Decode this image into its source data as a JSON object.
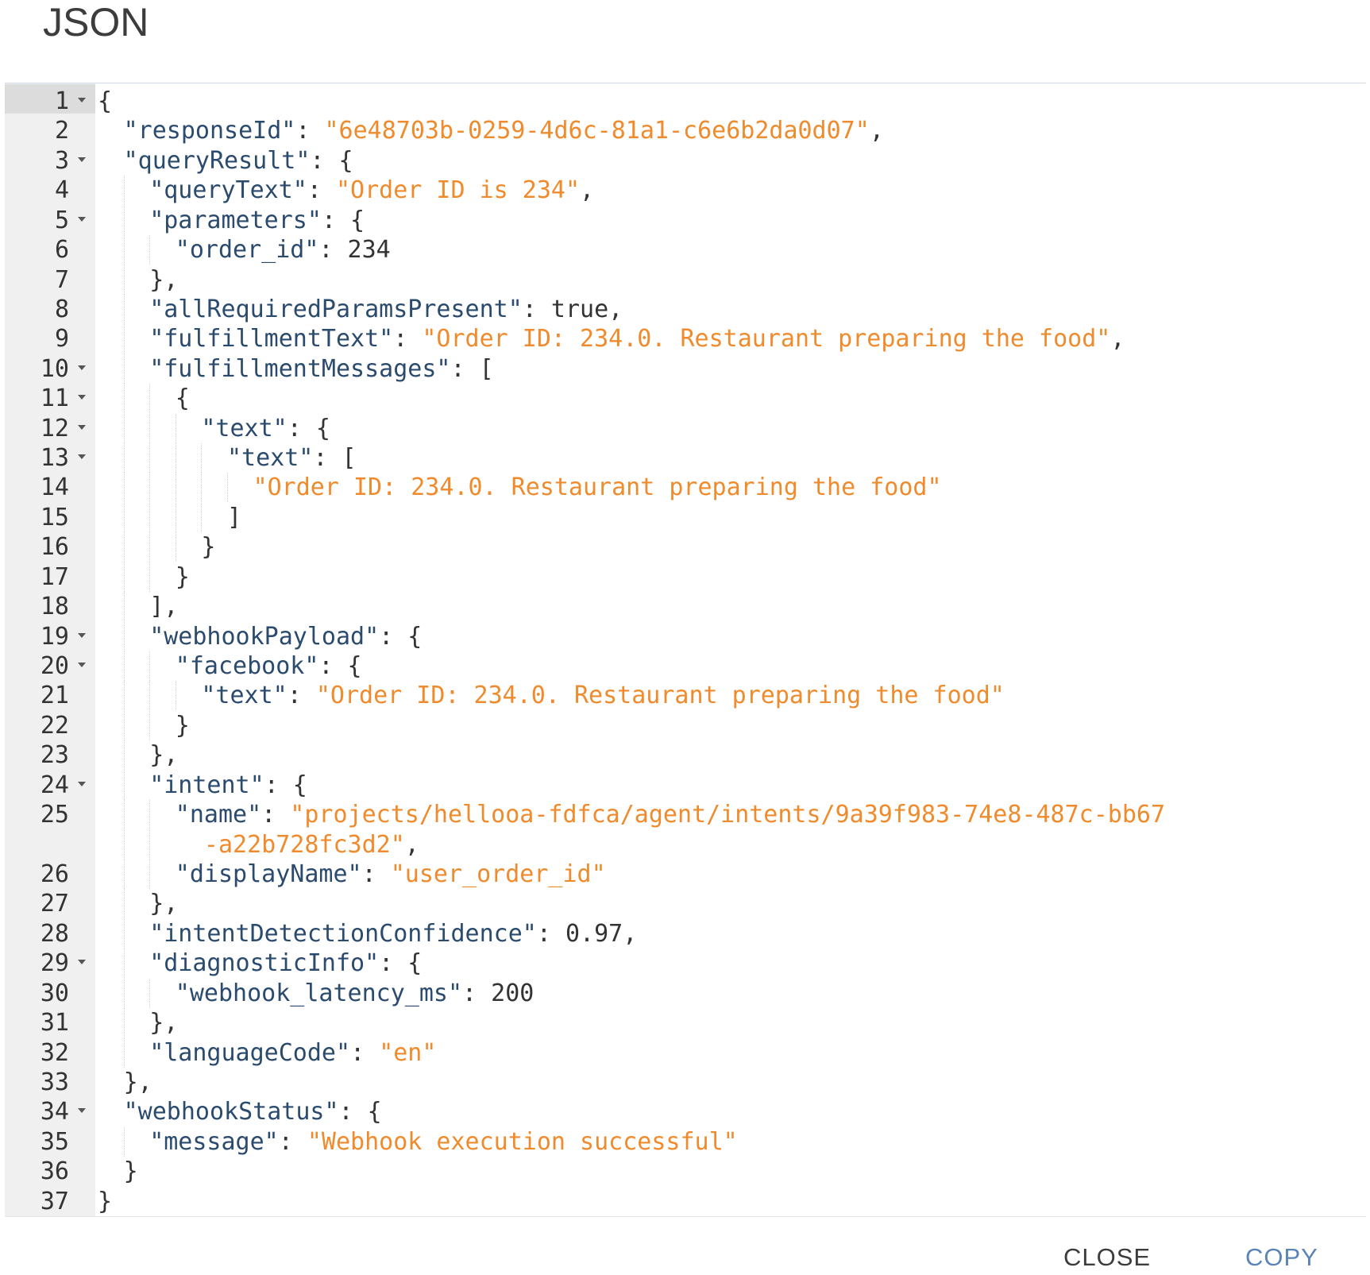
{
  "dialog": {
    "title": "JSON",
    "close_label": "CLOSE",
    "copy_label": "COPY"
  },
  "colors": {
    "key": "#2b4b6e",
    "string": "#ef8b2c",
    "text": "#333333",
    "copy_button": "#5b84b8",
    "gutter": "#f0f0f0"
  },
  "editor": {
    "lines": [
      {
        "num": "1",
        "fold": true,
        "indent": 0,
        "tokens": [
          [
            "punc",
            "{"
          ]
        ]
      },
      {
        "num": "2",
        "fold": false,
        "indent": 1,
        "tokens": [
          [
            "key",
            "\"responseId\""
          ],
          [
            "punc",
            ": "
          ],
          [
            "str",
            "\"6e48703b-0259-4d6c-81a1-c6e6b2da0d07\""
          ],
          [
            "punc",
            ","
          ]
        ]
      },
      {
        "num": "3",
        "fold": true,
        "indent": 1,
        "tokens": [
          [
            "key",
            "\"queryResult\""
          ],
          [
            "punc",
            ": {"
          ]
        ]
      },
      {
        "num": "4",
        "fold": false,
        "indent": 2,
        "tokens": [
          [
            "key",
            "\"queryText\""
          ],
          [
            "punc",
            ": "
          ],
          [
            "str",
            "\"Order ID is 234\""
          ],
          [
            "punc",
            ","
          ]
        ]
      },
      {
        "num": "5",
        "fold": true,
        "indent": 2,
        "tokens": [
          [
            "key",
            "\"parameters\""
          ],
          [
            "punc",
            ": {"
          ]
        ]
      },
      {
        "num": "6",
        "fold": false,
        "indent": 3,
        "tokens": [
          [
            "key",
            "\"order_id\""
          ],
          [
            "punc",
            ": "
          ],
          [
            "num",
            "234"
          ]
        ]
      },
      {
        "num": "7",
        "fold": false,
        "indent": 2,
        "tokens": [
          [
            "punc",
            "},"
          ]
        ]
      },
      {
        "num": "8",
        "fold": false,
        "indent": 2,
        "tokens": [
          [
            "key",
            "\"allRequiredParamsPresent\""
          ],
          [
            "punc",
            ": "
          ],
          [
            "bool",
            "true"
          ],
          [
            "punc",
            ","
          ]
        ]
      },
      {
        "num": "9",
        "fold": false,
        "indent": 2,
        "tokens": [
          [
            "key",
            "\"fulfillmentText\""
          ],
          [
            "punc",
            ": "
          ],
          [
            "str",
            "\"Order ID: 234.0. Restaurant preparing the food\""
          ],
          [
            "punc",
            ","
          ]
        ]
      },
      {
        "num": "10",
        "fold": true,
        "indent": 2,
        "tokens": [
          [
            "key",
            "\"fulfillmentMessages\""
          ],
          [
            "punc",
            ": ["
          ]
        ]
      },
      {
        "num": "11",
        "fold": true,
        "indent": 3,
        "tokens": [
          [
            "punc",
            "{"
          ]
        ]
      },
      {
        "num": "12",
        "fold": true,
        "indent": 4,
        "tokens": [
          [
            "key",
            "\"text\""
          ],
          [
            "punc",
            ": {"
          ]
        ]
      },
      {
        "num": "13",
        "fold": true,
        "indent": 5,
        "tokens": [
          [
            "key",
            "\"text\""
          ],
          [
            "punc",
            ": ["
          ]
        ]
      },
      {
        "num": "14",
        "fold": false,
        "indent": 6,
        "tokens": [
          [
            "str",
            "\"Order ID: 234.0. Restaurant preparing the food\""
          ]
        ]
      },
      {
        "num": "15",
        "fold": false,
        "indent": 5,
        "tokens": [
          [
            "punc",
            "]"
          ]
        ]
      },
      {
        "num": "16",
        "fold": false,
        "indent": 4,
        "tokens": [
          [
            "punc",
            "}"
          ]
        ]
      },
      {
        "num": "17",
        "fold": false,
        "indent": 3,
        "tokens": [
          [
            "punc",
            "}"
          ]
        ]
      },
      {
        "num": "18",
        "fold": false,
        "indent": 2,
        "tokens": [
          [
            "punc",
            "],"
          ]
        ]
      },
      {
        "num": "19",
        "fold": true,
        "indent": 2,
        "tokens": [
          [
            "key",
            "\"webhookPayload\""
          ],
          [
            "punc",
            ": {"
          ]
        ]
      },
      {
        "num": "20",
        "fold": true,
        "indent": 3,
        "tokens": [
          [
            "key",
            "\"facebook\""
          ],
          [
            "punc",
            ": {"
          ]
        ]
      },
      {
        "num": "21",
        "fold": false,
        "indent": 4,
        "tokens": [
          [
            "key",
            "\"text\""
          ],
          [
            "punc",
            ": "
          ],
          [
            "str",
            "\"Order ID: 234.0. Restaurant preparing the food\""
          ]
        ]
      },
      {
        "num": "22",
        "fold": false,
        "indent": 3,
        "tokens": [
          [
            "punc",
            "}"
          ]
        ]
      },
      {
        "num": "23",
        "fold": false,
        "indent": 2,
        "tokens": [
          [
            "punc",
            "},"
          ]
        ]
      },
      {
        "num": "24",
        "fold": true,
        "indent": 2,
        "tokens": [
          [
            "key",
            "\"intent\""
          ],
          [
            "punc",
            ": {"
          ]
        ]
      },
      {
        "num": "25",
        "fold": false,
        "indent": 3,
        "tokens": [
          [
            "key",
            "\"name\""
          ],
          [
            "punc",
            ": "
          ],
          [
            "str",
            "\"projects/hellooa-fdfca/agent/intents/9a39f983-74e8-487c-bb67"
          ]
        ]
      },
      {
        "num": "",
        "fold": false,
        "wrap": true,
        "indent": 3,
        "tokens": [
          [
            "str",
            "  -a22b728fc3d2\""
          ],
          [
            "punc",
            ","
          ]
        ]
      },
      {
        "num": "26",
        "fold": false,
        "indent": 3,
        "tokens": [
          [
            "key",
            "\"displayName\""
          ],
          [
            "punc",
            ": "
          ],
          [
            "str",
            "\"user_order_id\""
          ]
        ]
      },
      {
        "num": "27",
        "fold": false,
        "indent": 2,
        "tokens": [
          [
            "punc",
            "},"
          ]
        ]
      },
      {
        "num": "28",
        "fold": false,
        "indent": 2,
        "tokens": [
          [
            "key",
            "\"intentDetectionConfidence\""
          ],
          [
            "punc",
            ": "
          ],
          [
            "num",
            "0.97"
          ],
          [
            "punc",
            ","
          ]
        ]
      },
      {
        "num": "29",
        "fold": true,
        "indent": 2,
        "tokens": [
          [
            "key",
            "\"diagnosticInfo\""
          ],
          [
            "punc",
            ": {"
          ]
        ]
      },
      {
        "num": "30",
        "fold": false,
        "indent": 3,
        "tokens": [
          [
            "key",
            "\"webhook_latency_ms\""
          ],
          [
            "punc",
            ": "
          ],
          [
            "num",
            "200"
          ]
        ]
      },
      {
        "num": "31",
        "fold": false,
        "indent": 2,
        "tokens": [
          [
            "punc",
            "},"
          ]
        ]
      },
      {
        "num": "32",
        "fold": false,
        "indent": 2,
        "tokens": [
          [
            "key",
            "\"languageCode\""
          ],
          [
            "punc",
            ": "
          ],
          [
            "str",
            "\"en\""
          ]
        ]
      },
      {
        "num": "33",
        "fold": false,
        "indent": 1,
        "tokens": [
          [
            "punc",
            "},"
          ]
        ]
      },
      {
        "num": "34",
        "fold": true,
        "indent": 1,
        "tokens": [
          [
            "key",
            "\"webhookStatus\""
          ],
          [
            "punc",
            ": {"
          ]
        ]
      },
      {
        "num": "35",
        "fold": false,
        "indent": 2,
        "tokens": [
          [
            "key",
            "\"message\""
          ],
          [
            "punc",
            ": "
          ],
          [
            "str",
            "\"Webhook execution successful\""
          ]
        ]
      },
      {
        "num": "36",
        "fold": false,
        "indent": 1,
        "tokens": [
          [
            "punc",
            "}"
          ]
        ]
      },
      {
        "num": "37",
        "fold": false,
        "indent": 0,
        "tokens": [
          [
            "punc",
            "}"
          ]
        ]
      }
    ]
  }
}
